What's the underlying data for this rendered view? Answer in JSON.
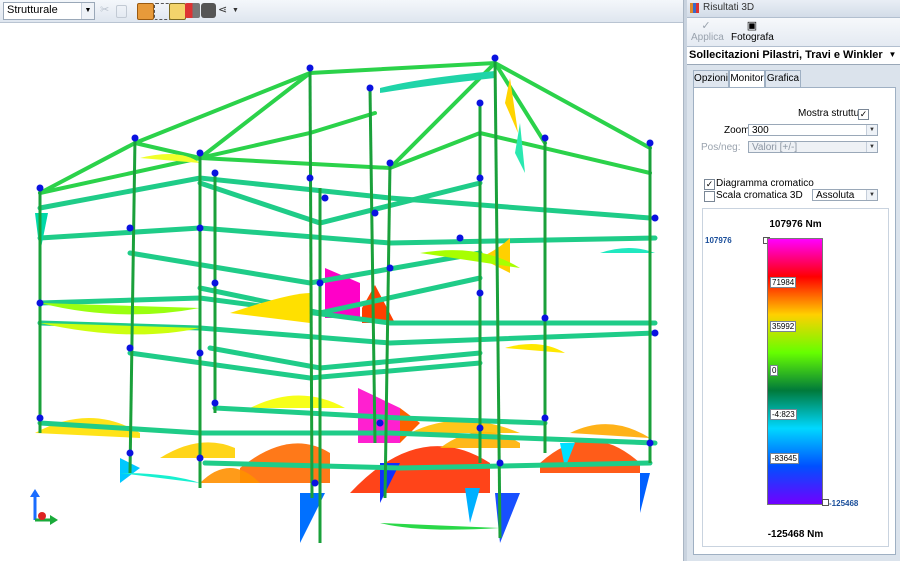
{
  "toolbar": {
    "view_selector": "Strutturale",
    "icons": [
      "cut-icon",
      "copy-icon",
      "box-icon",
      "select-frame-icon",
      "layers-icon",
      "delete-results-icon",
      "camera-icon",
      "share-icon"
    ]
  },
  "panel": {
    "title": "Risultati 3D",
    "apply_label": "Applica",
    "photo_label": "Fotografa",
    "selector_value": "Sollecitazioni Pilastri, Travi e Winkler",
    "tabs": [
      {
        "label": "Opzioni",
        "active": false
      },
      {
        "label": "Monitor",
        "active": true
      },
      {
        "label": "Grafica",
        "active": false
      }
    ],
    "show_structure_label": "Mostra struttura",
    "show_structure_checked": true,
    "zoom_label": "Zoom:",
    "zoom_value": "300",
    "posneg_label": "Pos/neg:",
    "posneg_value": "Valori [+/-]",
    "color_diagram_label": "Diagramma cromatico",
    "color_diagram_checked": true,
    "color_scale_label": "Scala cromatica 3D",
    "color_scale_checked": false,
    "scale_mode": "Assoluta"
  },
  "legend": {
    "max_title": "107976 Nm",
    "min_title": "-125468 Nm",
    "max_marker": "107976",
    "min_marker": "-125468",
    "ticks": [
      "71984",
      "35992",
      "0",
      "-4:823",
      "-83645"
    ],
    "colors": [
      "#ff00ff",
      "#ff0000",
      "#ffd000",
      "#66ff00",
      "#007a3a",
      "#00d8ff",
      "#0050ff",
      "#7000ff"
    ]
  }
}
